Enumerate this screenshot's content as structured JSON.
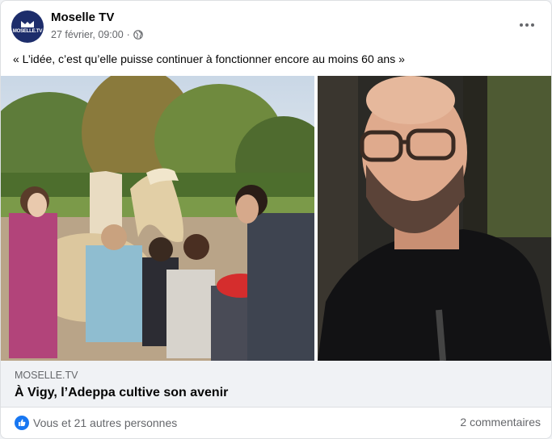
{
  "post": {
    "page_name": "Moselle TV",
    "timestamp": "27 février, 09:00",
    "separator": "·",
    "avatar_text": "MOSELLE.TV",
    "text": "« L’idée, c’est qu’elle puisse continuer à fonctionner encore au moins 60 ans »"
  },
  "link": {
    "domain": "MOSELLE.TV",
    "title": "À Vigy, l’Adeppa cultive son avenir"
  },
  "footer": {
    "reactions_text": "Vous et 21 autres personnes",
    "comments_text": "2 commentaires"
  },
  "colors": {
    "brand": "#1d2d6b",
    "like_blue": "#1877f2",
    "secondary_text": "#65676b"
  },
  "icons": {
    "privacy": "globe-icon",
    "more": "more-options-icon",
    "reaction": "like-icon"
  }
}
